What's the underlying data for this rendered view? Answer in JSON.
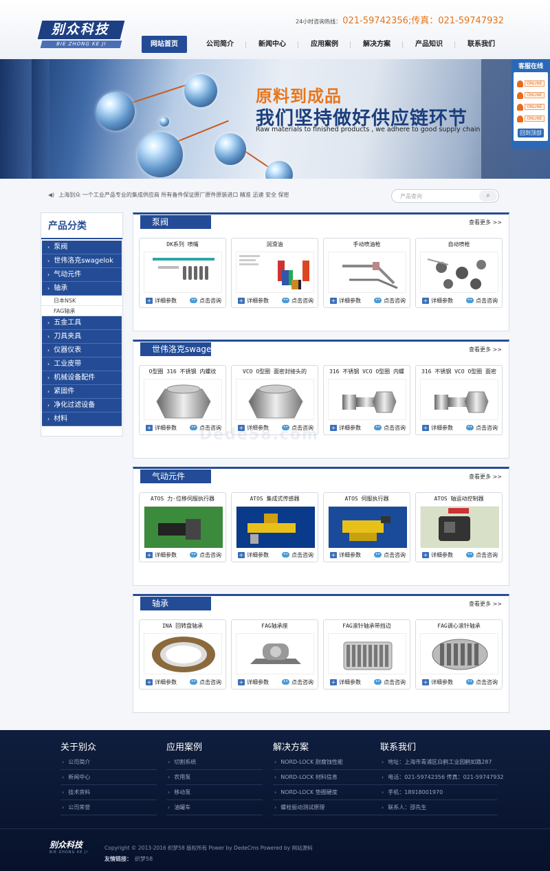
{
  "header": {
    "logo_text": "别众科技",
    "logo_sub": "BIE ZHONG KE JI",
    "hotline_label": "24小时咨询热线：",
    "hotline_numbers": "021-59742356;传真：021-59747932"
  },
  "nav": [
    "网站首页",
    "公司简介",
    "新闻中心",
    "应用案例",
    "解决方案",
    "产品知识",
    "联系我们"
  ],
  "banner": {
    "title": "原料到成品",
    "subtitle": "我们坚持做好供应链环节",
    "english": "Raw materials to finished products , we adhere to good supply chain"
  },
  "service": {
    "title": "客服在线",
    "status": "ONLINE",
    "back": "回到顶部"
  },
  "notice": "上海别众 一个工业产品专业的集成供应商 所有备件保证原厂原件原装进口 精准 迅速 安全 保密",
  "search": {
    "placeholder": "产品查询"
  },
  "sidebar": {
    "title": "产品分类",
    "items": [
      {
        "label": "泵阀",
        "subs": []
      },
      {
        "label": "世伟洛克swagelok",
        "subs": []
      },
      {
        "label": "气动元件",
        "subs": []
      },
      {
        "label": "轴承",
        "subs": [
          "日本NSK",
          "FAG轴承"
        ]
      },
      {
        "label": "五金工具",
        "subs": []
      },
      {
        "label": "刀具夹具",
        "subs": []
      },
      {
        "label": "仪器仪表",
        "subs": []
      },
      {
        "label": "工业皮带",
        "subs": []
      },
      {
        "label": "机械设备配件",
        "subs": []
      },
      {
        "label": "紧固件",
        "subs": []
      },
      {
        "label": "净化过滤设备",
        "subs": []
      },
      {
        "label": "材料",
        "subs": []
      }
    ]
  },
  "sections": [
    {
      "title": "泵阀",
      "more": "查看更多 >>",
      "products": [
        "DK系列 喷嘴",
        "润滑油",
        "手动喷油枪",
        "自动喷枪"
      ]
    },
    {
      "title": "世伟洛克swagelok",
      "more": "查看更多 >>",
      "products": [
        "O型圈 316 不锈钢 内螺纹",
        "VCO O型圈 面密封接头的",
        "316 不锈钢 VCO O型圈 内螺",
        "316 不锈钢 VCO O型圈 面密"
      ]
    },
    {
      "title": "气动元件",
      "more": "查看更多 >>",
      "products": [
        "ATOS 力-位移伺服执行器",
        "ATOS 集成式传感器",
        "ATOS 伺服执行器",
        "ATOS 轴运动控制器"
      ]
    },
    {
      "title": "轴承",
      "more": "查看更多 >>",
      "products": [
        "INA 回转盘轴承",
        "FAG轴承座",
        "FAG滚针轴承带挡边",
        "FAG调心滚针轴承"
      ]
    }
  ],
  "card_actions": {
    "detail": "详细参数",
    "consult": "点击咨询"
  },
  "footer": {
    "cols": [
      {
        "title": "关于别众",
        "items": [
          "公司简介",
          "新闻中心",
          "技术资料",
          "公司荣誉"
        ]
      },
      {
        "title": "应用案例",
        "items": [
          "切割系统",
          "农用泵",
          "移动泵",
          "油罐车"
        ]
      },
      {
        "title": "解决方案",
        "items": [
          "NORD-LOCK 耐腐蚀性能",
          "NORD-LOCK 材料信息",
          "NORD-LOCK 垫圈硬度",
          "螺栓振动测试原理"
        ]
      },
      {
        "title": "联系我们",
        "items": [
          "地址：上海市青浦区白鹤工业园鹤如路287",
          "电话：021-59742356 传真：021-59747932",
          "手机：18918001970",
          "联系人：邵先生"
        ]
      }
    ],
    "logo": "别众科技",
    "logo_sub": "BIE ZHONG KE JI",
    "copyright": "Copyright © 2013-2016 织梦58 版权所有 Power by DedeCms Powered by 网站源码",
    "links_label": "友情链接：",
    "links": "织梦58"
  },
  "watermark": "Dede58.com",
  "colors": {
    "primary": "#244c96",
    "accent": "#e8761c",
    "footer": "#0f1e3e"
  }
}
